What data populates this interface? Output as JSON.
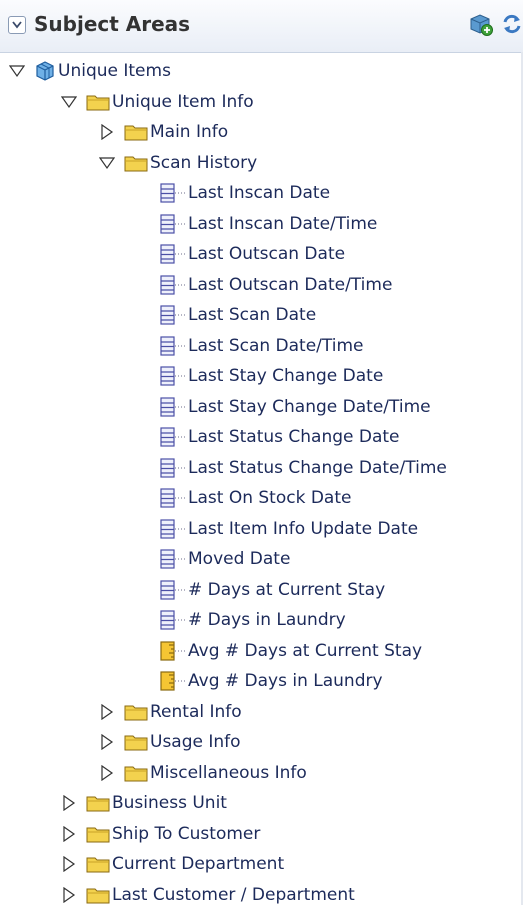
{
  "header": {
    "title": "Subject Areas"
  },
  "tree": [
    {
      "label": "Unique Items",
      "level": 0,
      "expanded": true,
      "icon": "cube"
    },
    {
      "label": "Unique Item Info",
      "level": 1,
      "expanded": true,
      "icon": "folder"
    },
    {
      "label": "Main Info",
      "level": 2,
      "expanded": false,
      "icon": "folder"
    },
    {
      "label": "Scan History",
      "level": 2,
      "expanded": true,
      "icon": "folder"
    },
    {
      "label": "Last Inscan Date",
      "level": 3,
      "icon": "column"
    },
    {
      "label": "Last Inscan Date/Time",
      "level": 3,
      "icon": "column"
    },
    {
      "label": "Last Outscan Date",
      "level": 3,
      "icon": "column"
    },
    {
      "label": "Last Outscan Date/Time",
      "level": 3,
      "icon": "column"
    },
    {
      "label": "Last Scan Date",
      "level": 3,
      "icon": "column"
    },
    {
      "label": "Last Scan Date/Time",
      "level": 3,
      "icon": "column"
    },
    {
      "label": "Last Stay Change Date",
      "level": 3,
      "icon": "column"
    },
    {
      "label": "Last Stay Change Date/Time",
      "level": 3,
      "icon": "column"
    },
    {
      "label": "Last Status Change Date",
      "level": 3,
      "icon": "column"
    },
    {
      "label": "Last Status Change Date/Time",
      "level": 3,
      "icon": "column"
    },
    {
      "label": "Last On Stock Date",
      "level": 3,
      "icon": "column"
    },
    {
      "label": "Last Item Info Update Date",
      "level": 3,
      "icon": "column"
    },
    {
      "label": "Moved Date",
      "level": 3,
      "icon": "column"
    },
    {
      "label": "# Days at Current Stay",
      "level": 3,
      "icon": "column"
    },
    {
      "label": "# Days in Laundry",
      "level": 3,
      "icon": "column"
    },
    {
      "label": "Avg # Days at Current Stay",
      "level": 3,
      "icon": "measure"
    },
    {
      "label": "Avg # Days in Laundry",
      "level": 3,
      "icon": "measure"
    },
    {
      "label": "Rental Info",
      "level": 2,
      "expanded": false,
      "icon": "folder"
    },
    {
      "label": "Usage Info",
      "level": 2,
      "expanded": false,
      "icon": "folder"
    },
    {
      "label": "Miscellaneous Info",
      "level": 2,
      "expanded": false,
      "icon": "folder"
    },
    {
      "label": "Business Unit",
      "level": 1,
      "expanded": false,
      "icon": "folder"
    },
    {
      "label": "Ship To Customer",
      "level": 1,
      "expanded": false,
      "icon": "folder"
    },
    {
      "label": "Current Department",
      "level": 1,
      "expanded": false,
      "icon": "folder"
    },
    {
      "label": "Last Customer / Department",
      "level": 1,
      "expanded": false,
      "icon": "folder"
    }
  ]
}
